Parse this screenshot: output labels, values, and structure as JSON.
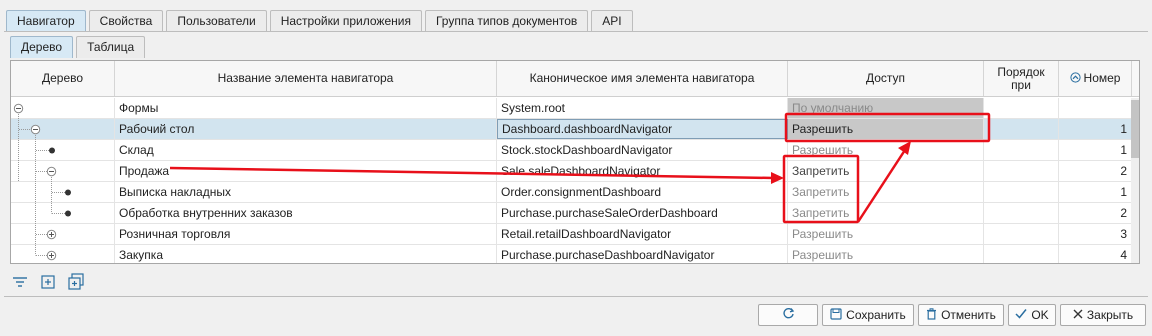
{
  "tabs": [
    "Навигатор",
    "Свойства",
    "Пользователи",
    "Настройки приложения",
    "Группа типов документов",
    "API"
  ],
  "subtabs": [
    "Дерево",
    "Таблица"
  ],
  "columns": {
    "tree": "Дерево",
    "name": "Название элемента навигатора",
    "canonical": "Каноническое имя элемента навигатора",
    "access": "Доступ",
    "order": "Порядок при",
    "number": "Номер"
  },
  "rows": [
    {
      "name": "Формы",
      "canonical": "System.root",
      "access": "По умолчанию",
      "number": ""
    },
    {
      "name": "Рабочий стол",
      "canonical": "Dashboard.dashboardNavigator",
      "access": "Разрешить",
      "number": "1"
    },
    {
      "name": "Склад",
      "canonical": "Stock.stockDashboardNavigator",
      "access": "Разрешить",
      "number": "1"
    },
    {
      "name": "Продажа",
      "canonical": "Sale.saleDashboardNavigator",
      "access": "Запретить",
      "number": "2"
    },
    {
      "name": "Выписка накладных",
      "canonical": "Order.consignmentDashboard",
      "access": "Запретить",
      "number": "1"
    },
    {
      "name": "Обработка внутренних заказов",
      "canonical": "Purchase.purchaseSaleOrderDashboard",
      "access": "Запретить",
      "number": "2"
    },
    {
      "name": "Розничная торговля",
      "canonical": "Retail.retailDashboardNavigator",
      "access": "Разрешить",
      "number": "3"
    },
    {
      "name": "Закупка",
      "canonical": "Purchase.purchaseDashboardNavigator",
      "access": "Разрешить",
      "number": "4"
    }
  ],
  "buttons": {
    "save": "Сохранить",
    "cancel": "Отменить",
    "ok": "OK",
    "close": "Закрыть"
  },
  "icons": {
    "refresh": "refresh-icon",
    "save": "floppy-icon",
    "cancel": "trash-icon",
    "ok": "check-icon",
    "close": "close-icon",
    "filter": "filter-icon",
    "expand": "expand-all-icon",
    "collapse": "collapse-all-icon"
  },
  "colors": {
    "annotation": "#e8101a",
    "active_tab": "#d7e9f5",
    "selected_row": "#d2e4ef"
  }
}
